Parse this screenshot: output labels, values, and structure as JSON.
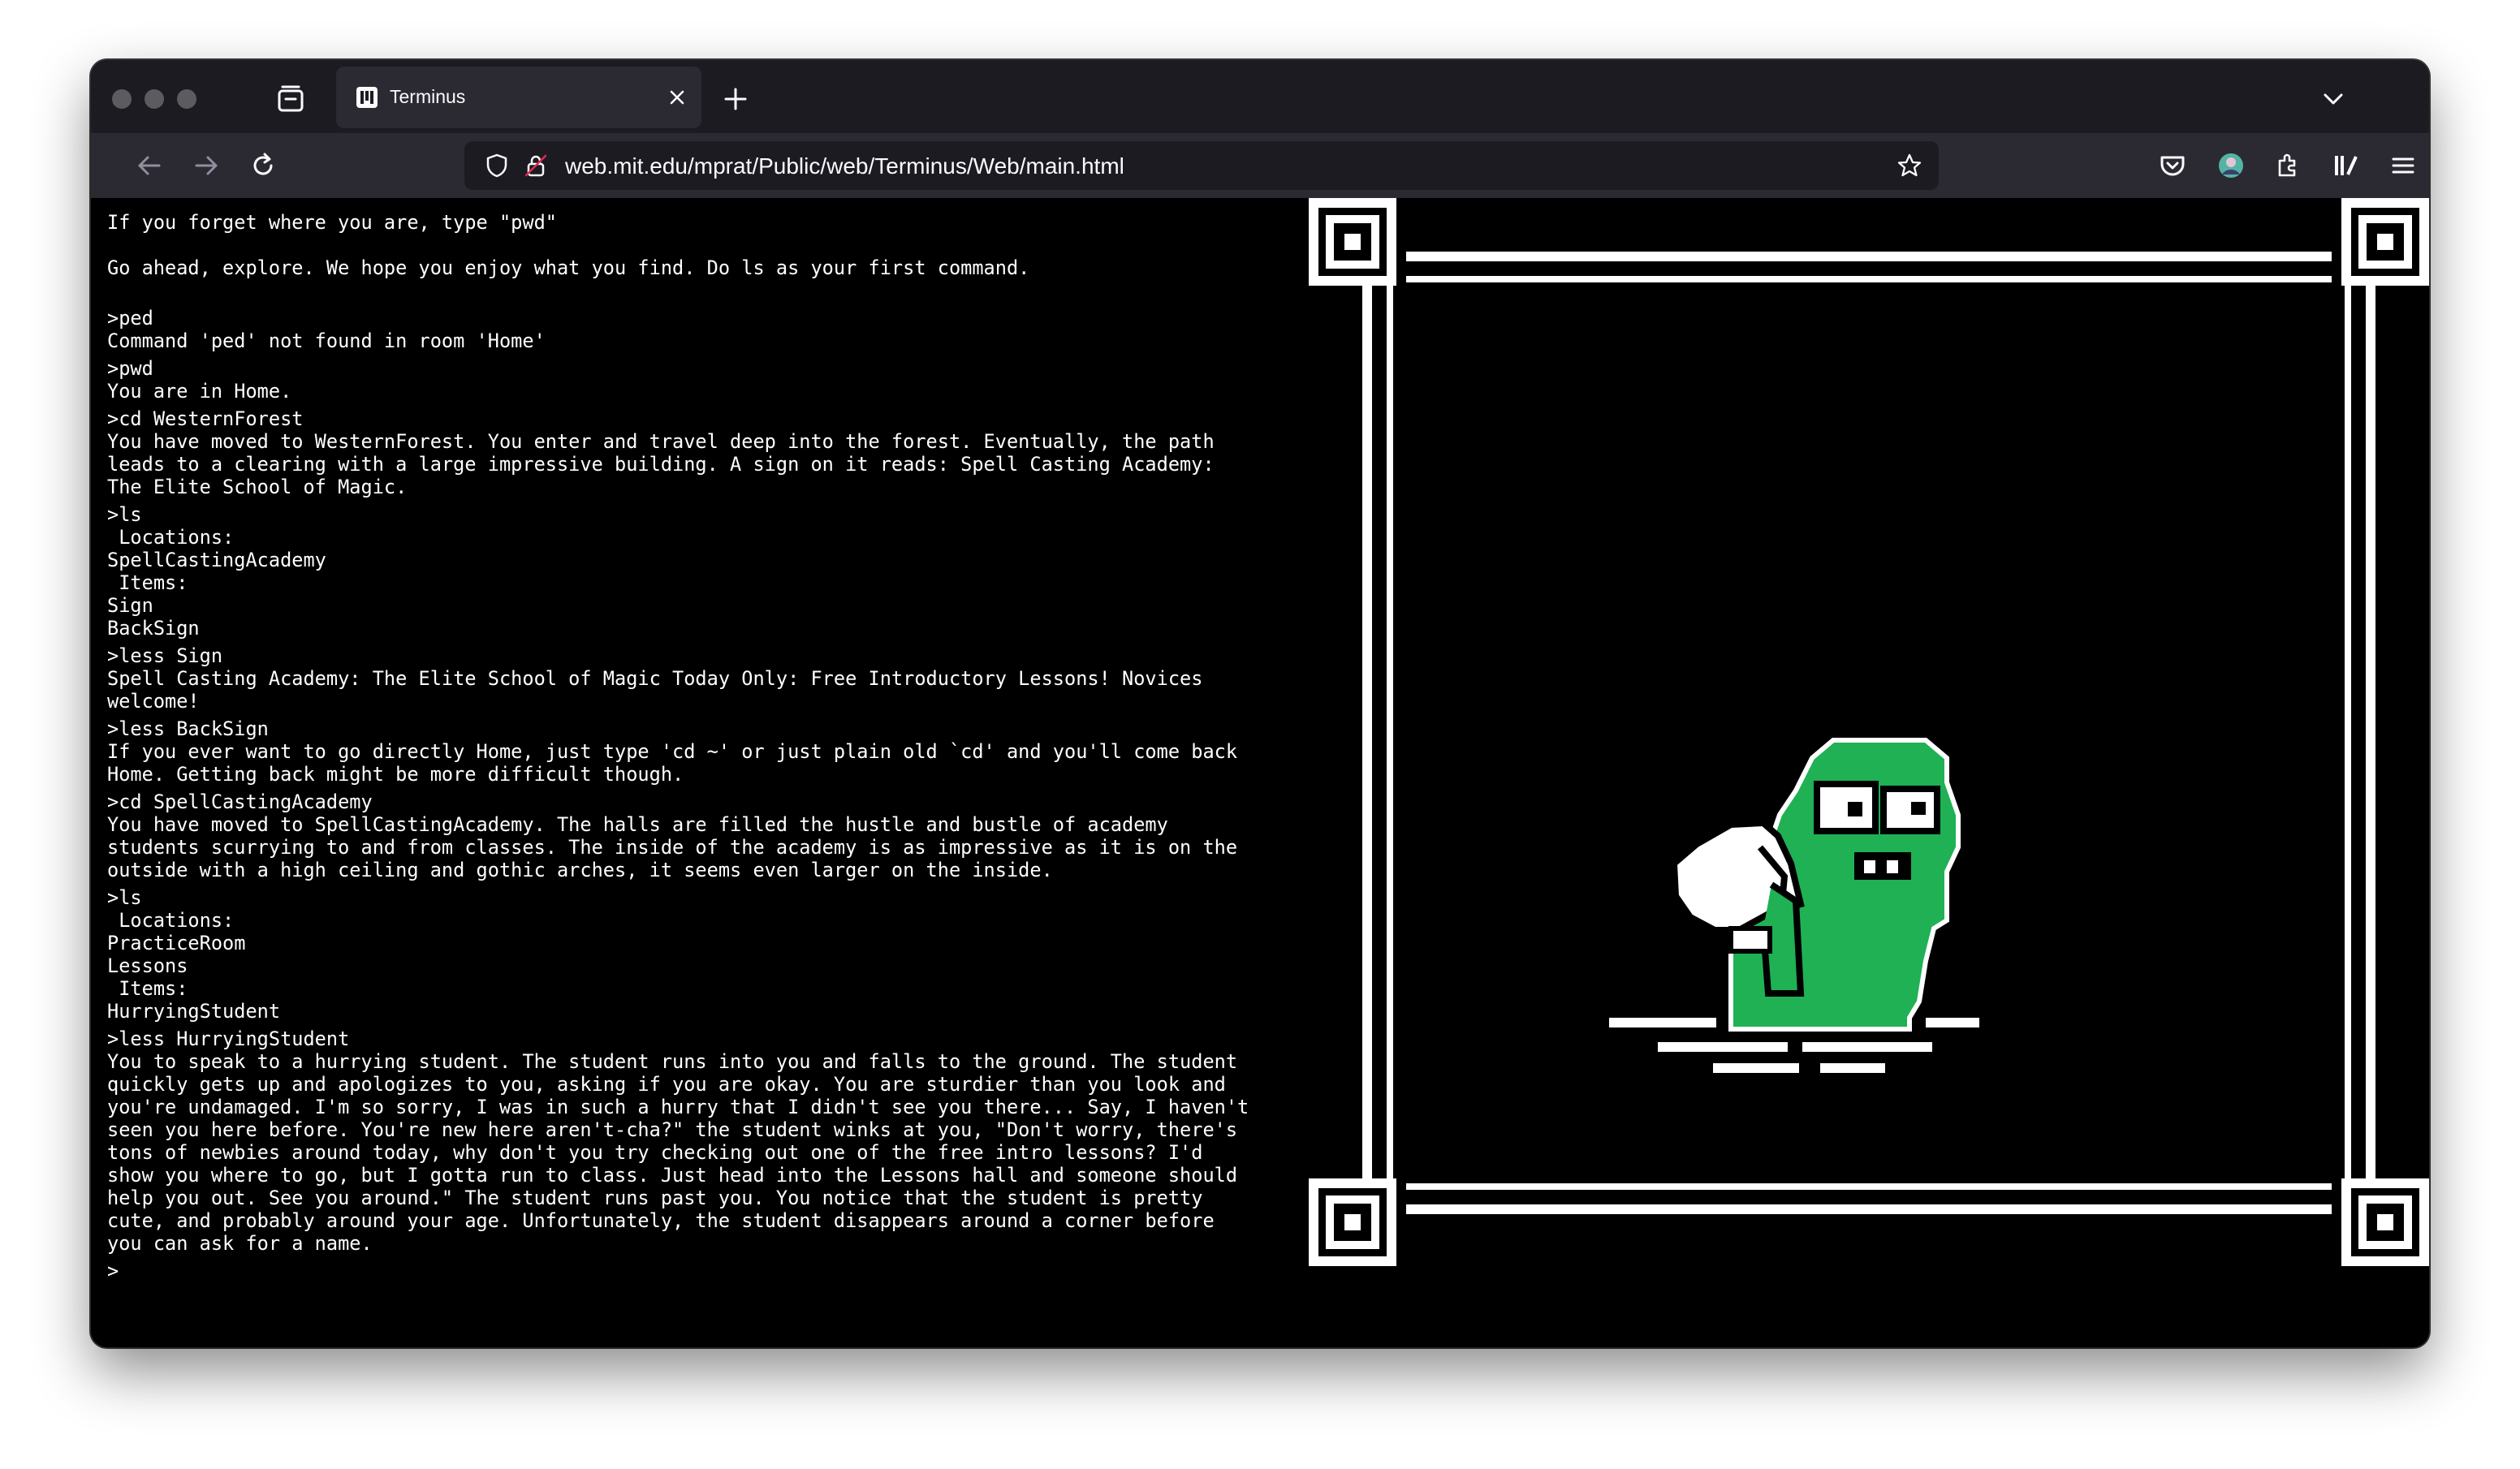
{
  "browser": {
    "tab_title": "Terminus",
    "url": "web.mit.edu/mprat/Public/web/Terminus/Web/main.html",
    "icons": {
      "traffic_lights": "window-controls",
      "tab_manager": "tab-manager-icon",
      "tab_favicon": "terminus-favicon",
      "tab_close": "close-icon",
      "new_tab": "plus-icon",
      "list_all_tabs": "chevron-down-icon",
      "back": "back-arrow-icon",
      "forward": "forward-arrow-icon",
      "reload": "reload-icon",
      "tracking_protection": "shield-icon",
      "insecure_lock": "lock-icon",
      "bookmark": "star-icon",
      "pocket": "pocket-icon",
      "account": "avatar-icon",
      "extensions": "puzzle-icon",
      "library": "library-icon",
      "menu": "hamburger-menu-icon"
    }
  },
  "terminal": {
    "lines": [
      "If you forget where you are, type \"pwd\"",
      "",
      "Go ahead, explore. We hope you enjoy what you find. Do ls as your first command.",
      "",
      ">ped",
      "Command 'ped' not found in room 'Home'",
      ">pwd",
      "You are in Home.",
      ">cd WesternForest",
      "You have moved to WesternForest. You enter and travel deep into the forest. Eventually, the path",
      "leads to a clearing with a large impressive building. A sign on it reads: Spell Casting Academy:",
      "The Elite School of Magic.",
      ">ls",
      " Locations:",
      "SpellCastingAcademy",
      " Items:",
      "Sign",
      "BackSign",
      ">less Sign",
      "Spell Casting Academy: The Elite School of Magic Today Only: Free Introductory Lessons! Novices",
      "welcome!",
      ">less BackSign",
      "If you ever want to go directly Home, just type 'cd ~' or just plain old `cd' and you'll come back",
      "Home. Getting back might be more difficult though.",
      ">cd SpellCastingAcademy",
      "You have moved to SpellCastingAcademy. The halls are filled the hustle and bustle of academy",
      "students scurrying to and from classes. The inside of the academy is as impressive as it is on the",
      "outside with a high ceiling and gothic arches, it seems even larger on the inside.",
      ">ls",
      " Locations:",
      "PracticeRoom",
      "Lessons",
      " Items:",
      "HurryingStudent",
      ">less HurryingStudent",
      "You to speak to a hurrying student. The student runs into you and falls to the ground. The student",
      "quickly gets up and apologizes to you, asking if you are okay. You are sturdier than you look and",
      "you're undamaged. I'm so sorry, I was in such a hurry that I didn't see you there... Say, I haven't",
      "seen you here before. You're new here aren't-cha?\" the student winks at you, \"Don't worry, there's",
      "tons of newbies around today, why don't you try checking out one of the free intro lessons? I'd",
      "show you where to go, but I gotta run to class. Just head into the Lessons hall and someone should",
      "help you out. See you around.\" The student runs past you. You notice that the student is pretty",
      "cute, and probably around your age. Unfortunately, the student disappears around a corner before",
      "you can ask for a name."
    ],
    "prompt": ">"
  },
  "art": {
    "subject": "pixel-art green blob student carrying a white sack inside a white greek-key frame",
    "colors": {
      "body": "#1fb154",
      "frame": "#ffffff",
      "background": "#000000"
    }
  }
}
